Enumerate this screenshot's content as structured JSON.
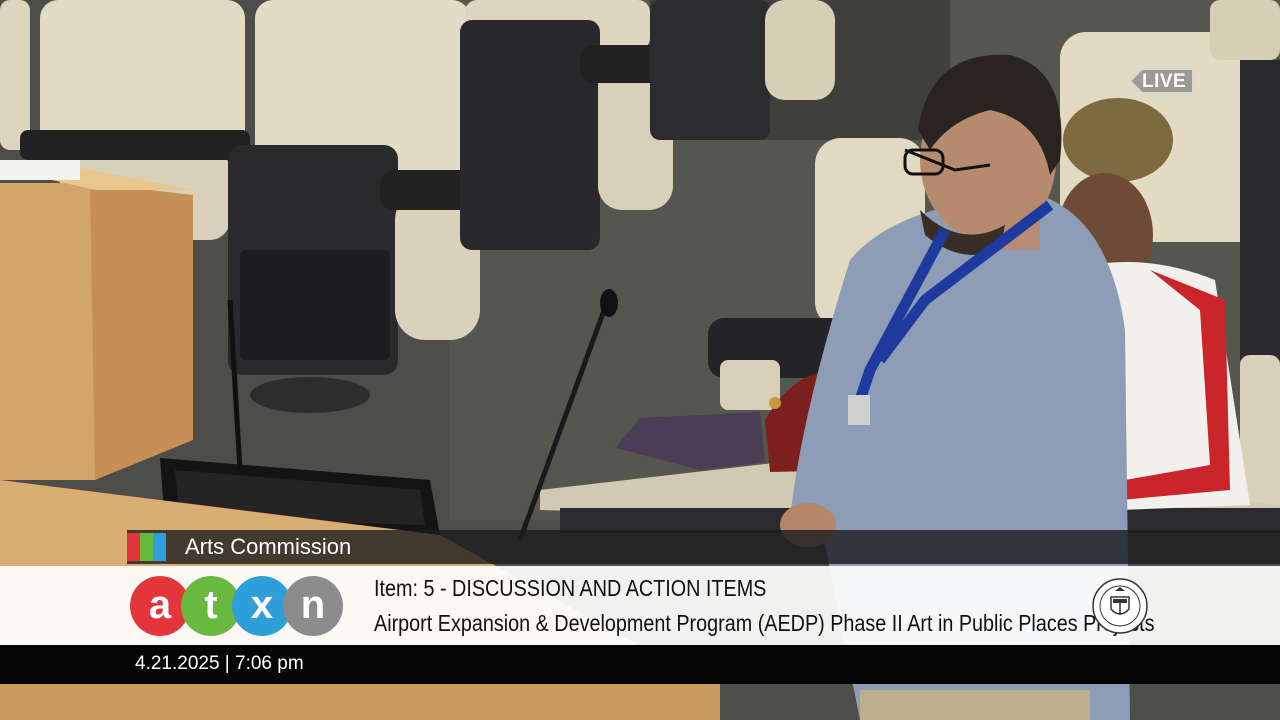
{
  "live_badge": {
    "label": "LIVE"
  },
  "commission": {
    "name": "Arts Commission",
    "accent_colors": [
      "#e2363a",
      "#69b83f",
      "#2e9fd9"
    ]
  },
  "logo": {
    "letters": [
      "a",
      "t",
      "x",
      "n"
    ],
    "colors": [
      "#e2363a",
      "#69b83f",
      "#2e9fd9",
      "#8c8c8c"
    ]
  },
  "agenda": {
    "item": "Item: 5 - DISCUSSION AND ACTION ITEMS",
    "subject": "Airport Expansion & Development Program (AEDP) Phase II Art in Public Places Projects"
  },
  "seal": {
    "icon": "city-seal-icon"
  },
  "timestamp": {
    "text": "4.21.2025 | 7:06 pm"
  }
}
